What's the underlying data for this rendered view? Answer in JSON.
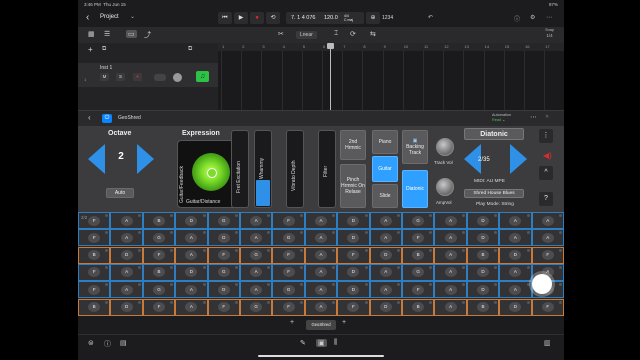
{
  "statusbar": {
    "time": "3:46 PM",
    "date": "Thu Jun 15",
    "right": "87%"
  },
  "header": {
    "title": "Project"
  },
  "lcd": {
    "position": "7. 1 4 076",
    "tempo": "120.0",
    "sig_top": "4/4",
    "sig_bottom": "C maj"
  },
  "count_in": "1234",
  "trackbar": {
    "automation_label": "Lnear",
    "snap_label": "Snap",
    "snap_value": "1/4"
  },
  "track": {
    "number": "1",
    "name": "Inst 1",
    "mute": "M",
    "solo": "S"
  },
  "ruler": [
    "1",
    "2",
    "3",
    "4",
    "5",
    "6",
    "7",
    "8",
    "9",
    "10",
    "11",
    "12",
    "13",
    "14",
    "15",
    "16",
    "17"
  ],
  "plugin": {
    "name": "GeoShred",
    "automation_label": "Automation",
    "automation_state": "Read"
  },
  "octave": {
    "title": "Octave",
    "value": "2",
    "auto_label": "Auto"
  },
  "expression": {
    "title": "Expression",
    "y_label": "Guitar/Feedback",
    "x_label": "Guitar/Distance"
  },
  "sliders": {
    "fret_excitation": "Fret Excitation",
    "whammy": "Whammy",
    "vibrato_depth": "Vibrato Depth",
    "filter": "Filter",
    "whammy_level": 0.45
  },
  "buttons": {
    "harmonic": "2nd Hrmnic",
    "pinch": "Pinch Hrmnic On Relase",
    "piano": "Piano",
    "guitar": "Guitar",
    "slide": "Slide",
    "backing": "Backing Track",
    "diatonic": "Diatonic"
  },
  "knobs": {
    "track_vol": "Track Vol",
    "amp_vol": "AmpVol"
  },
  "scale": {
    "title": "Diatonic",
    "value": "2/35",
    "midi": "MIDI: AU MPE",
    "preset": "Shred House Blues",
    "play_mode": "Play Mode: String"
  },
  "side": {
    "more": "⋮",
    "up": "^",
    "help": "?"
  },
  "fretboard": {
    "page": "2/2",
    "rows": [
      [
        "F",
        "A",
        "B",
        "D",
        "G",
        "A",
        "F",
        "A",
        "D",
        "A",
        "G",
        "A",
        "D",
        "A",
        "A"
      ],
      [
        "F",
        "A",
        "G",
        "A",
        "D",
        "A",
        "G",
        "A",
        "D",
        "A",
        "F",
        "A",
        "D",
        "A",
        "A"
      ],
      [
        "B",
        "D",
        "F",
        "A",
        "F",
        "G",
        "F",
        "A",
        "F",
        "D",
        "B",
        "A",
        "B",
        "D",
        "F"
      ],
      [
        "F",
        "A",
        "B",
        "D",
        "G",
        "A",
        "F",
        "A",
        "D",
        "A",
        "G",
        "A",
        "D",
        "A",
        "A"
      ],
      [
        "F",
        "A",
        "G",
        "A",
        "D",
        "A",
        "G",
        "A",
        "D",
        "A",
        "F",
        "A",
        "D",
        "A",
        "A"
      ],
      [
        "B",
        "D",
        "F",
        "A",
        "F",
        "G",
        "F",
        "A",
        "F",
        "D",
        "B",
        "A",
        "B",
        "D",
        "F"
      ]
    ]
  },
  "plugin_tab": {
    "label": "GeoShred"
  },
  "colors": {
    "accent": "#2e90e6",
    "green": "#3ec45a",
    "record": "#e02a2a"
  }
}
